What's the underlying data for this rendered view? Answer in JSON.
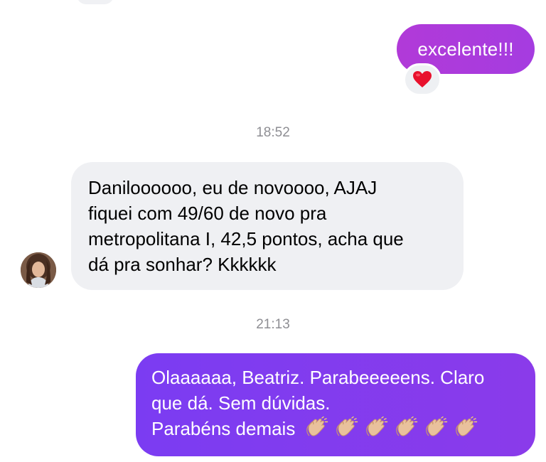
{
  "conversation": {
    "messages": [
      {
        "direction": "outgoing",
        "text": "excelente!!!",
        "reaction": "heart-icon"
      },
      {
        "direction": "timestamp",
        "text": "18:52"
      },
      {
        "direction": "incoming",
        "lines": [
          "Daniloooooo, eu de novoooo, AJAJ",
          "fiquei com 49/60 de novo pra",
          "metropolitana I, 42,5 pontos, acha que",
          "dá pra sonhar? Kkkkkk"
        ]
      },
      {
        "direction": "timestamp",
        "text": "21:13"
      },
      {
        "direction": "outgoing",
        "lines": [
          "Olaaaaaa, Beatriz. Parabeeeeens. Claro",
          "que dá. Sem dúvidas.",
          "Parabéns demais"
        ],
        "emoji": [
          "clapping-hands-icon",
          "clapping-hands-icon",
          "clapping-hands-icon",
          "clapping-hands-icon",
          "clapping-hands-icon",
          "clapping-hands-icon"
        ]
      }
    ]
  },
  "colors": {
    "outgoing_first": "#b13ad8",
    "outgoing_second": "#7b3cf2",
    "incoming": "#eff0f3",
    "timestamp": "#8e8e93"
  }
}
